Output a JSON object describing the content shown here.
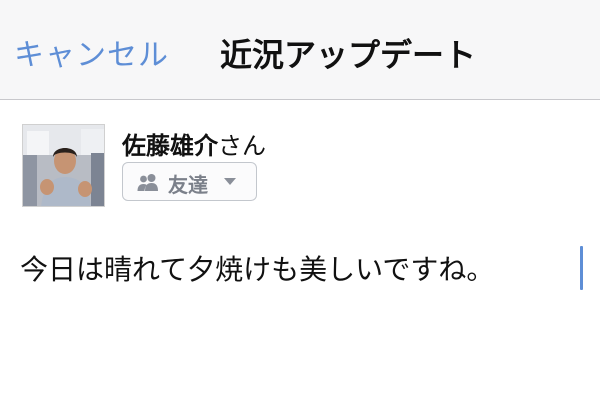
{
  "navbar": {
    "cancel_label": "キャンセル",
    "title": "近況アップデート"
  },
  "post": {
    "user_name": "佐藤雄介",
    "honorific": "さん",
    "audience_label": "友達",
    "audience_icon": "friends-icon",
    "text": "今日は晴れて夕焼けも美しいですね。"
  },
  "colors": {
    "accent": "#5e8ed6",
    "navbar_bg": "#f7f7f8",
    "audience_text": "#7b808a"
  }
}
